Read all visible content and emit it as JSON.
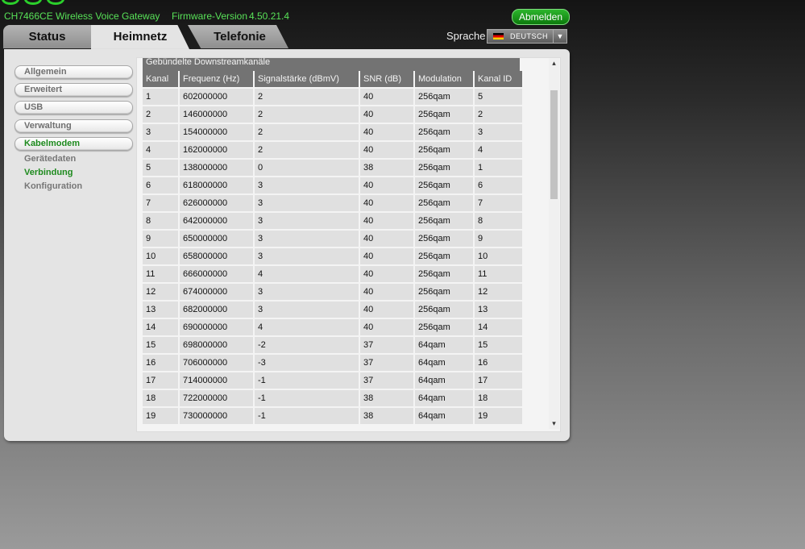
{
  "header": {
    "model": "CH7466CE",
    "product": "Wireless Voice Gateway",
    "firmware_label": "Firmware-Version",
    "firmware_version": "4.50.21.4",
    "logout_label": "Abmelden"
  },
  "tabs": [
    {
      "label": "Status"
    },
    {
      "label": "Heimnetz"
    },
    {
      "label": "Telefonie"
    }
  ],
  "language": {
    "label": "Sprache",
    "selected": "DEUTSCH"
  },
  "sidebar": {
    "items": [
      {
        "label": "Allgemein"
      },
      {
        "label": "Erweitert"
      },
      {
        "label": "USB"
      },
      {
        "label": "Verwaltung"
      },
      {
        "label": "Kabelmodem"
      }
    ],
    "subitems": [
      {
        "label": "Gerätedaten"
      },
      {
        "label": "Verbindung"
      },
      {
        "label": "Konfiguration"
      }
    ]
  },
  "table": {
    "title": "Gebündelte Downstreamkanäle",
    "columns": [
      "Kanal",
      "Frequenz (Hz)",
      "Signalstärke (dBmV)",
      "SNR (dB)",
      "Modulation",
      "Kanal ID"
    ],
    "rows": [
      [
        "1",
        "602000000",
        "2",
        "40",
        "256qam",
        "5"
      ],
      [
        "2",
        "146000000",
        "2",
        "40",
        "256qam",
        "2"
      ],
      [
        "3",
        "154000000",
        "2",
        "40",
        "256qam",
        "3"
      ],
      [
        "4",
        "162000000",
        "2",
        "40",
        "256qam",
        "4"
      ],
      [
        "5",
        "138000000",
        "0",
        "38",
        "256qam",
        "1"
      ],
      [
        "6",
        "618000000",
        "3",
        "40",
        "256qam",
        "6"
      ],
      [
        "7",
        "626000000",
        "3",
        "40",
        "256qam",
        "7"
      ],
      [
        "8",
        "642000000",
        "3",
        "40",
        "256qam",
        "8"
      ],
      [
        "9",
        "650000000",
        "3",
        "40",
        "256qam",
        "9"
      ],
      [
        "10",
        "658000000",
        "3",
        "40",
        "256qam",
        "10"
      ],
      [
        "11",
        "666000000",
        "4",
        "40",
        "256qam",
        "11"
      ],
      [
        "12",
        "674000000",
        "3",
        "40",
        "256qam",
        "12"
      ],
      [
        "13",
        "682000000",
        "3",
        "40",
        "256qam",
        "13"
      ],
      [
        "14",
        "690000000",
        "4",
        "40",
        "256qam",
        "14"
      ],
      [
        "15",
        "698000000",
        "-2",
        "37",
        "64qam",
        "15"
      ],
      [
        "16",
        "706000000",
        "-3",
        "37",
        "64qam",
        "16"
      ],
      [
        "17",
        "714000000",
        "-1",
        "37",
        "64qam",
        "17"
      ],
      [
        "18",
        "722000000",
        "-1",
        "38",
        "64qam",
        "18"
      ],
      [
        "19",
        "730000000",
        "-1",
        "38",
        "64qam",
        "19"
      ]
    ]
  },
  "icons": {
    "scroll_up": "▴",
    "scroll_down": "▾",
    "dropdown_caret": "▼"
  },
  "colors": {
    "accent_green": "#58e258",
    "active_green": "#1d8a1d",
    "table_header": "#737373",
    "table_cell": "#e0e0e0"
  }
}
